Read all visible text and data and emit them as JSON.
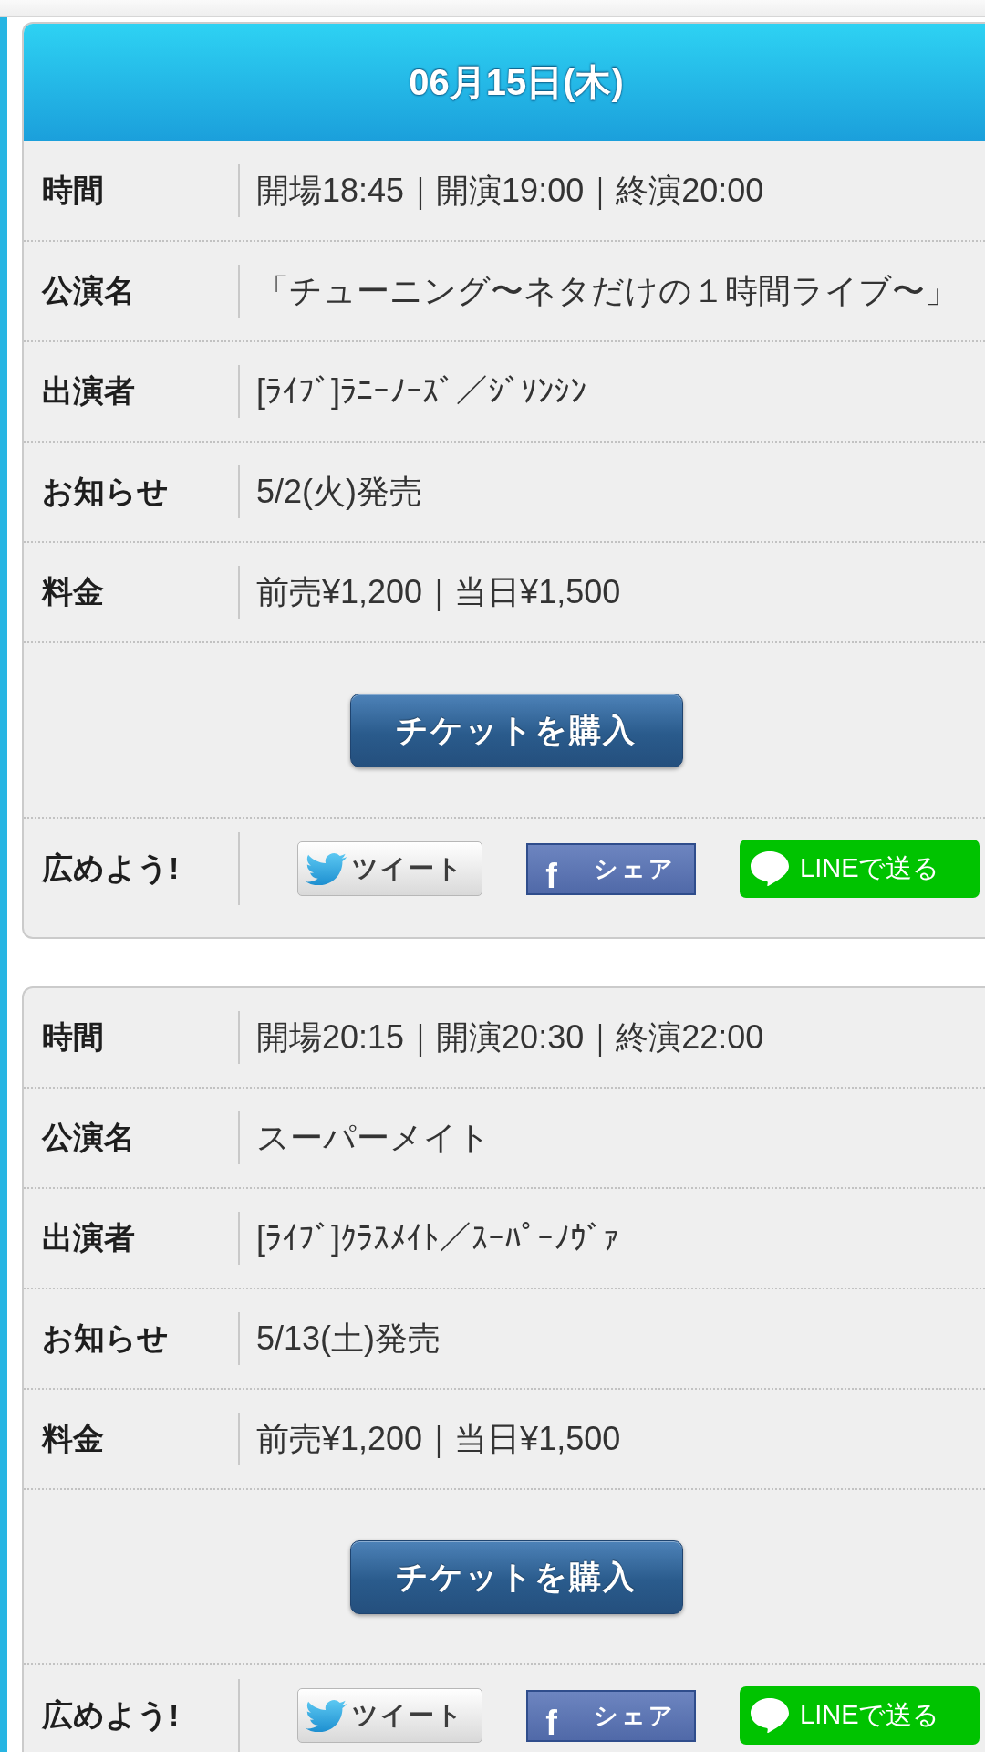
{
  "events": [
    {
      "date": "06月15日(木)",
      "rows": [
        {
          "label": "時間",
          "value": "開場18:45｜開演19:00｜終演20:00"
        },
        {
          "label": "公演名",
          "value": "「チューニング〜ネタだけの１時間ライブ〜」"
        },
        {
          "label": "出演者",
          "value": "[ﾗｲﾌﾞ]ﾗﾆｰﾉｰｽﾞ／ｼﾞｿﾝｼﾝ"
        },
        {
          "label": "お知らせ",
          "value": "5/2(火)発売"
        },
        {
          "label": "料金",
          "value": "前売¥1,200｜当日¥1,500"
        }
      ],
      "buy_button": "チケットを購入",
      "share": {
        "label": "広めよう!",
        "buttons": [
          {
            "kind": "tweet",
            "label": "ツイート"
          },
          {
            "kind": "facebook",
            "icon": "f",
            "label": "シェア"
          },
          {
            "kind": "line",
            "label": "LINEで送る"
          }
        ]
      }
    },
    {
      "rows": [
        {
          "label": "時間",
          "value": "開場20:15｜開演20:30｜終演22:00"
        },
        {
          "label": "公演名",
          "value": "スーパーメイト"
        },
        {
          "label": "出演者",
          "value": "[ﾗｲﾌﾞ]ｸﾗｽﾒｲﾄ／ｽｰﾊﾟｰﾉｳﾞｧ"
        },
        {
          "label": "お知らせ",
          "value": "5/13(土)発売"
        },
        {
          "label": "料金",
          "value": "前売¥1,200｜当日¥1,500"
        }
      ],
      "buy_button": "チケットを購入",
      "share": {
        "label": "広めよう!",
        "buttons": [
          {
            "kind": "tweet",
            "label": "ツイート"
          },
          {
            "kind": "facebook",
            "icon": "f",
            "label": "シェア"
          },
          {
            "kind": "line",
            "label": "LINEで送る"
          }
        ]
      }
    }
  ]
}
